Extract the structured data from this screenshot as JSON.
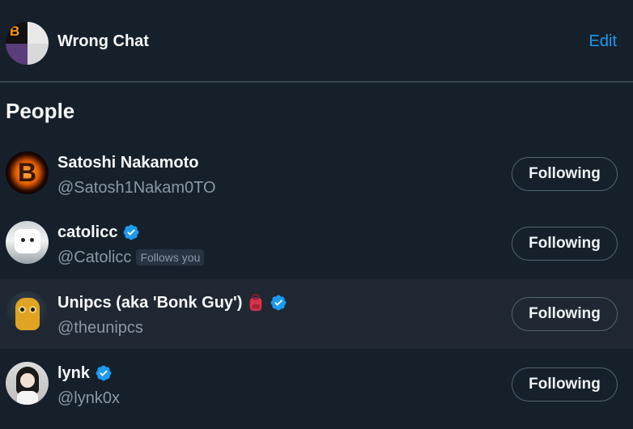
{
  "header": {
    "title": "Wrong Chat",
    "edit_label": "Edit"
  },
  "section": {
    "title": "People"
  },
  "people": [
    {
      "name": "Satoshi Nakamoto",
      "handle": "@Satosh1Nakam0TO",
      "verified": false,
      "follows_you": "",
      "button_label": "Following"
    },
    {
      "name": "catolicc",
      "handle": "@Catolicc",
      "verified": true,
      "follows_you": "Follows you",
      "button_label": "Following"
    },
    {
      "name": "Unipcs (aka 'Bonk Guy')",
      "handle": "@theunipcs",
      "verified": true,
      "follows_you": "",
      "emoji": "backpack-icon",
      "button_label": "Following"
    },
    {
      "name": "lynk",
      "handle": "@lynk0x",
      "verified": true,
      "follows_you": "",
      "button_label": "Following"
    }
  ],
  "colors": {
    "background": "#15202b",
    "accent": "#1d9bf0",
    "secondary_text": "#8b98a5",
    "divider": "#38444d"
  }
}
